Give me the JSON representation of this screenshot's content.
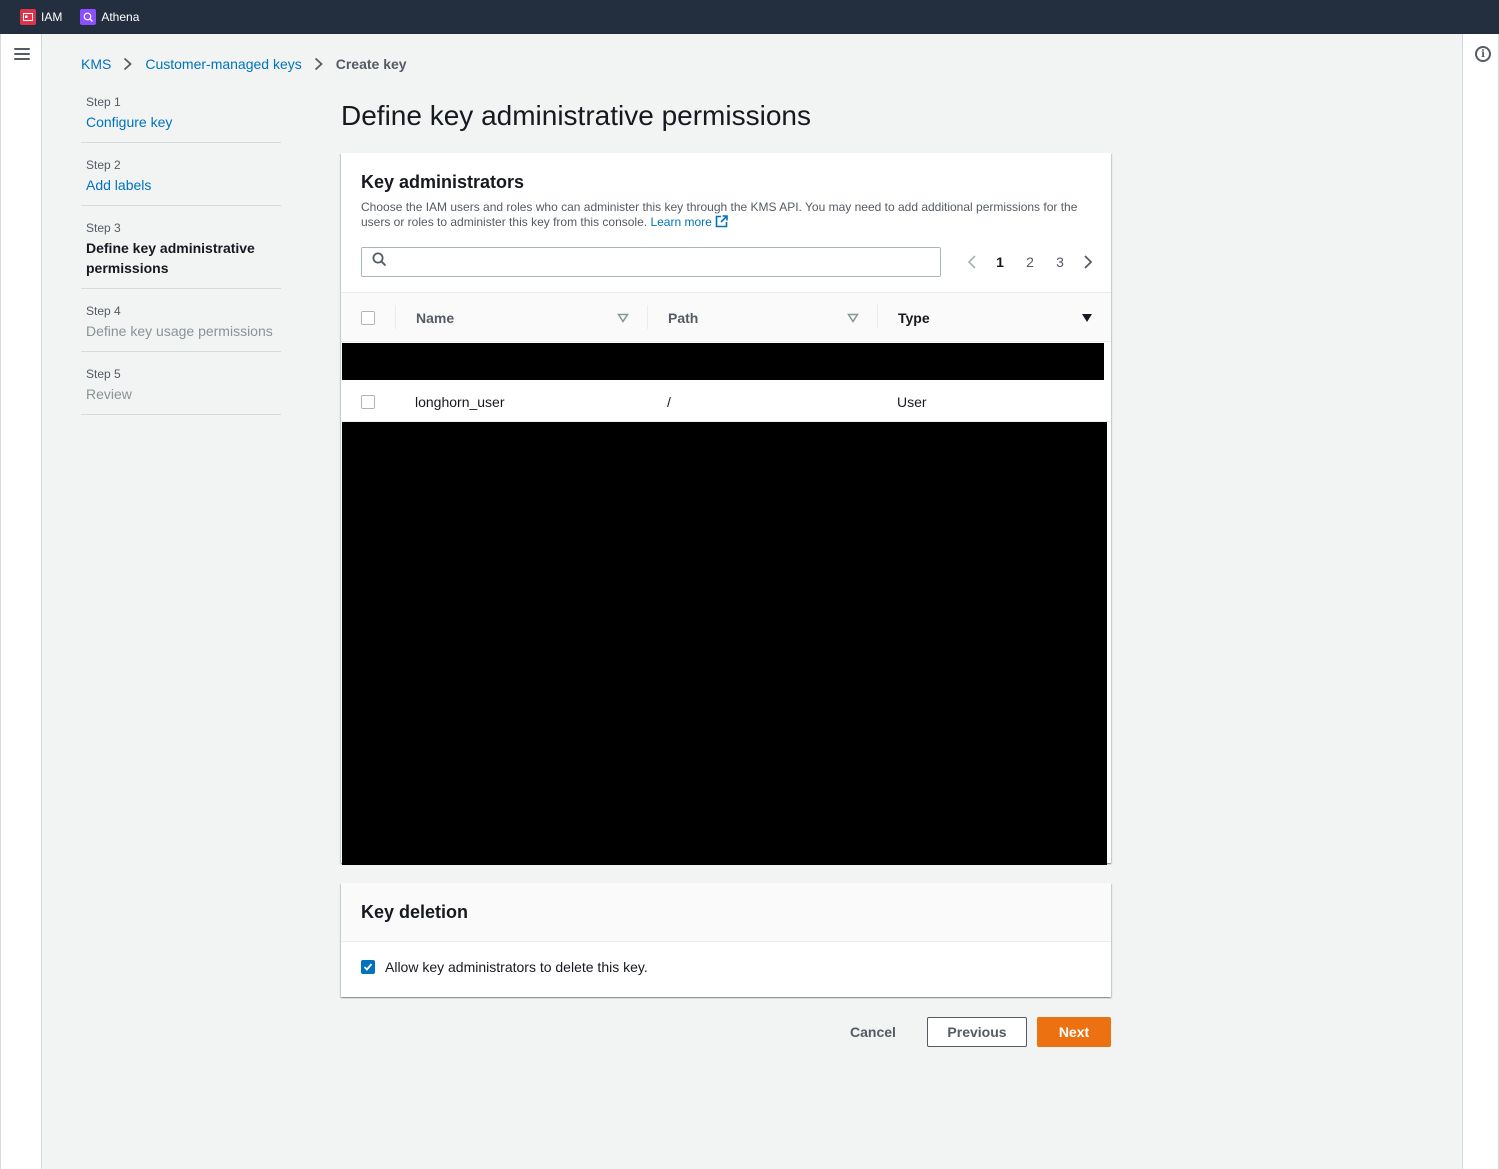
{
  "top_bar": {
    "services": [
      {
        "label": "IAM",
        "icon": "iam-service-icon",
        "color": "#dd344c"
      },
      {
        "label": "Athena",
        "icon": "athena-service-icon",
        "color": "#8c4fff"
      }
    ]
  },
  "breadcrumb": {
    "items": [
      "KMS",
      "Customer-managed keys"
    ],
    "current": "Create key"
  },
  "steps": [
    {
      "number": "Step 1",
      "title": "Configure key",
      "state": "link"
    },
    {
      "number": "Step 2",
      "title": "Add labels",
      "state": "link"
    },
    {
      "number": "Step 3",
      "title": "Define key administrative permissions",
      "state": "current"
    },
    {
      "number": "Step 4",
      "title": "Define key usage permissions",
      "state": "disabled"
    },
    {
      "number": "Step 5",
      "title": "Review",
      "state": "disabled"
    }
  ],
  "page_title": "Define key administrative permissions",
  "key_administrators": {
    "title": "Key administrators",
    "description": "Choose the IAM users and roles who can administer this key through the KMS API. You may need to add additional permissions for the users or roles to administer this key from this console.",
    "learn_more": "Learn more",
    "search": {
      "value": "",
      "placeholder": ""
    },
    "pagination": {
      "pages": [
        "1",
        "2",
        "3"
      ],
      "current": "1"
    },
    "columns": [
      "Name",
      "Path",
      "Type"
    ],
    "rows": [
      {
        "name": "longhorn_user",
        "path": "/",
        "type": "User",
        "selected": false
      }
    ]
  },
  "key_deletion": {
    "title": "Key deletion",
    "checkbox_label": "Allow key administrators to delete this key.",
    "checked": true
  },
  "actions": {
    "cancel": "Cancel",
    "previous": "Previous",
    "next": "Next"
  },
  "colors": {
    "accent": "#0073bb",
    "primary_button": "#ec7211",
    "top_bar": "#232f3e"
  }
}
